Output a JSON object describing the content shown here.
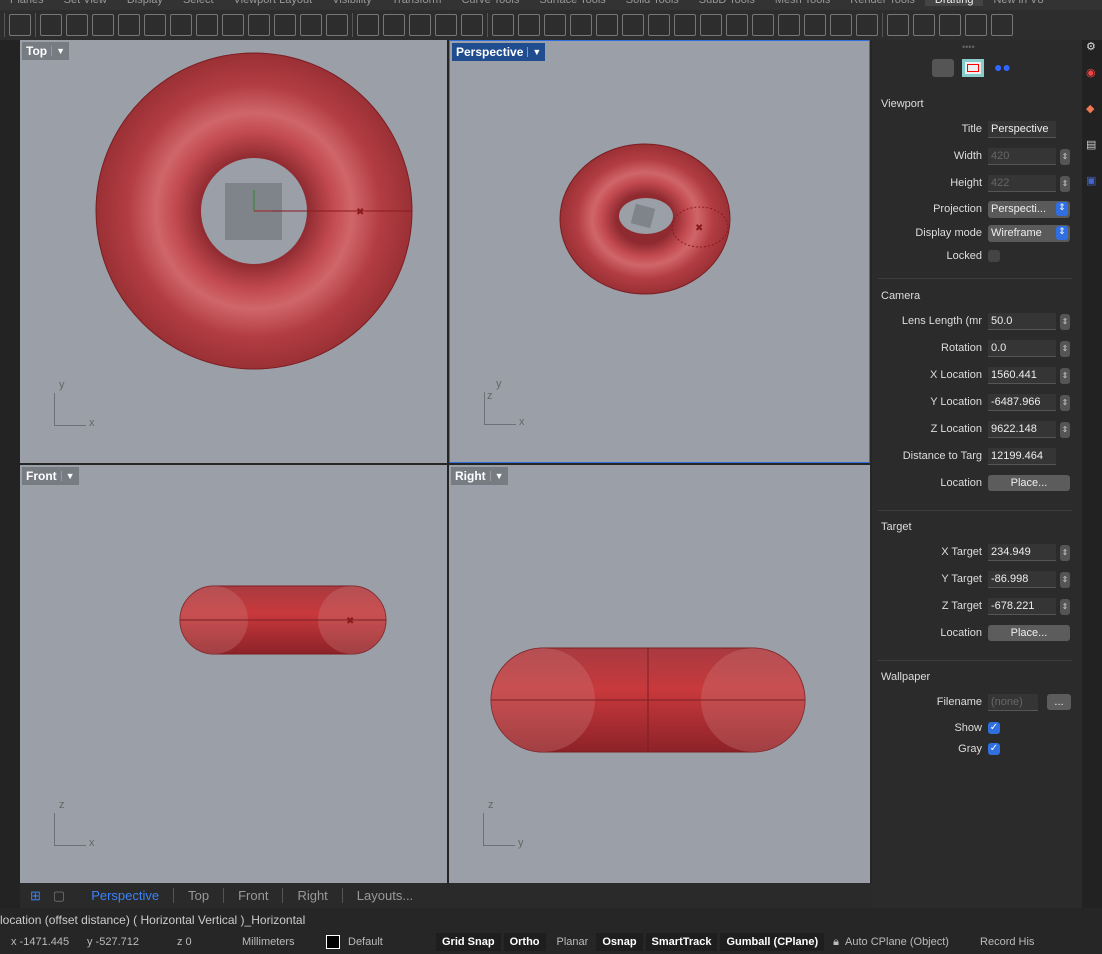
{
  "ribbon_tabs": [
    "Planes",
    "Set View",
    "Display",
    "Select",
    "Viewport Layout",
    "Visibility",
    "Transform",
    "Curve Tools",
    "Surface Tools",
    "Solid Tools",
    "SubD Tools",
    "Mesh Tools",
    "Render Tools",
    "Drafting",
    "New in V8"
  ],
  "active_ribbon_tab": "Drafting",
  "viewports": {
    "top": "Top",
    "perspective": "Perspective",
    "front": "Front",
    "right": "Right"
  },
  "axes": {
    "x": "x",
    "y": "y",
    "z": "z"
  },
  "viewport_tabs": [
    "Perspective",
    "Top",
    "Front",
    "Right",
    "Layouts..."
  ],
  "command_line": "location (offset distance) ( Horizontal Vertical )_Horizontal",
  "status": {
    "x": "x -1471.445",
    "y": "y -527.712",
    "z": "z 0",
    "units": "Millimeters",
    "layer": "Default",
    "grid_snap": "Grid Snap",
    "ortho": "Ortho",
    "planar": "Planar",
    "osnap": "Osnap",
    "smarttrack": "SmartTrack",
    "gumball": "Gumball (CPlane)",
    "auto_cplane": "Auto CPlane (Object)",
    "record_history": "Record His"
  },
  "panel": {
    "viewport_section": "Viewport",
    "title_label": "Title",
    "title": "Perspective",
    "width_label": "Width",
    "width": "420",
    "height_label": "Height",
    "height": "422",
    "projection_label": "Projection",
    "projection": "Perspecti...",
    "display_mode_label": "Display mode",
    "display_mode": "Wireframe",
    "locked_label": "Locked",
    "locked": false,
    "camera_section": "Camera",
    "lens_label": "Lens Length (mr",
    "lens": "50.0",
    "rotation_label": "Rotation",
    "rotation": "0.0",
    "xloc_label": "X Location",
    "xloc": "1560.441",
    "yloc_label": "Y Location",
    "yloc": "-6487.966",
    "zloc_label": "Z Location",
    "zloc": "9622.148",
    "dist_label": "Distance to Targ",
    "dist": "12199.464",
    "location_label": "Location",
    "place": "Place...",
    "target_section": "Target",
    "xt_label": "X Target",
    "xt": "234.949",
    "yt_label": "Y Target",
    "yt": "-86.998",
    "zt_label": "Z Target",
    "zt": "-678.221",
    "wallpaper_section": "Wallpaper",
    "filename_label": "Filename",
    "filename": "(none)",
    "browse": "...",
    "show_label": "Show",
    "show": true,
    "gray_label": "Gray",
    "gray": true
  },
  "colors": {
    "accent": "#2f6fe0",
    "viewport_bg": "#9b9fa7",
    "torus": "#b03a40"
  }
}
